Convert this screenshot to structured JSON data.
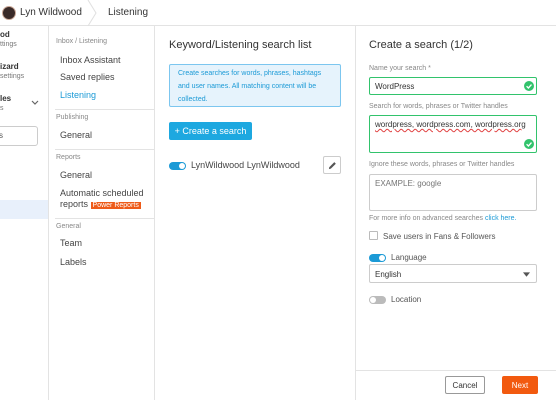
{
  "topbar": {
    "user_name": "Lyn Wildwood",
    "page_title": "Listening"
  },
  "leftnav": {
    "items": [
      {
        "main": "od",
        "sub": "ttings"
      },
      {
        "main": "izard",
        "sub": "settings"
      },
      {
        "main": "les",
        "sub": "s"
      }
    ],
    "search_fragment": "s"
  },
  "subnav": {
    "sections": [
      {
        "title": "Inbox / Listening",
        "items": [
          "Inbox Assistant",
          "Saved replies",
          "Listening"
        ]
      },
      {
        "title": "Publishing",
        "items": [
          "General"
        ]
      },
      {
        "title": "Reports",
        "items": [
          "General",
          "Automatic scheduled",
          "reports"
        ]
      },
      {
        "title": "General",
        "items": [
          "Team",
          "Labels"
        ]
      }
    ],
    "power_badge": "Power Reports",
    "active_item": "Listening"
  },
  "middle": {
    "title": "Keyword/Listening search list",
    "info_line1": "Create searches for words, phrases, hashtags",
    "info_line2": "and user names. All matching content will be",
    "info_line3": "collected.",
    "create_button": "+ Create a search",
    "search_items": [
      {
        "label": "LynWildwood LynWildwood",
        "enabled": true
      }
    ]
  },
  "right": {
    "title": "Create a search (1/2)",
    "name_label": "Name your search *",
    "name_value": "WordPress",
    "words_label": "Search for words, phrases or Twitter handles",
    "words_value": "wordpress, wordpress.com, wordpress.org",
    "ignore_label": "Ignore these words, phrases or Twitter handles",
    "ignore_placeholder": "EXAMPLE: google",
    "more_info_text": "For more info on advanced searches",
    "more_info_link": "click here.",
    "save_users_label": "Save users in Fans & Followers",
    "language_label": "Language",
    "language_value": "English",
    "location_label": "Location",
    "cancel_button": "Cancel",
    "next_button": "Next"
  },
  "colors": {
    "accent": "#1b9ad6",
    "valid": "#32c36c",
    "next": "#f25a0f",
    "power_badge": "#ee5b19"
  }
}
